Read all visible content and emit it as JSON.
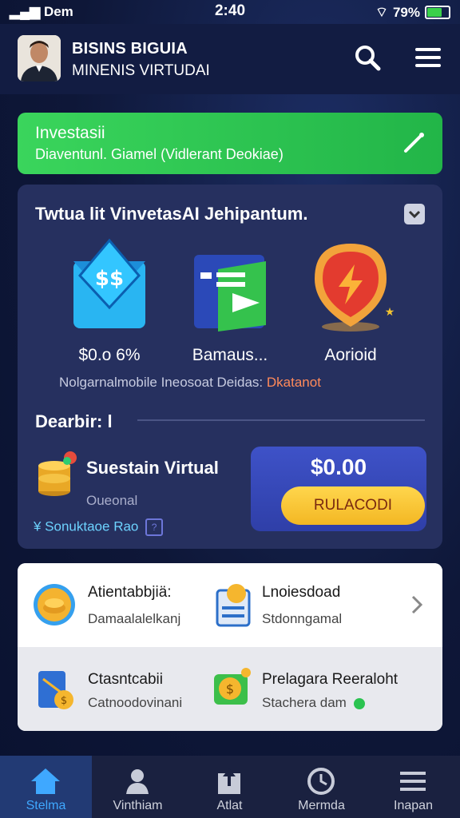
{
  "status_bar": {
    "carrier": "Dem",
    "time": "2:40",
    "battery": "79%"
  },
  "header": {
    "title_line1": "BISINS BIGUIA",
    "title_line2": "MINENIS VIRTUDAI"
  },
  "banner": {
    "title": "Investasii",
    "subtitle": "Diaventunl. Giamel (Vidlerant Deokiae)"
  },
  "card": {
    "title": "Twtua lit VinvetasAI Jehipantum.",
    "services": [
      {
        "label": "$0.o 6%"
      },
      {
        "label": "Bamaus..."
      },
      {
        "label": "Aorioid"
      }
    ],
    "sub_row_text": "Nolgarnalmobile  Ineosoat Deidas:",
    "sub_row_accent": "Dkatanot",
    "divider_label": "Dearbir: l",
    "sustain": {
      "title": "Suestain Virtual",
      "subtitle": "Oueonal",
      "link": "¥ Sonuktaoe Rao"
    },
    "payout": {
      "amount": "$0.00",
      "button": "RULACODI"
    }
  },
  "list": [
    {
      "title": "Atientabbjiä:",
      "subtitle": "Damaalalelkanj"
    },
    {
      "title": "Lnoiesdoad",
      "subtitle": "Stdonngamal"
    },
    {
      "title": "Ctasntcabii",
      "subtitle": "Catnoodovinani"
    },
    {
      "title": "Prelagara Reeraloht",
      "subtitle": "Stachera dam"
    }
  ],
  "nav": [
    {
      "label": "Stelma"
    },
    {
      "label": "Vinthiam"
    },
    {
      "label": "Atlat"
    },
    {
      "label": "Mermda"
    },
    {
      "label": "Inapan"
    }
  ],
  "colors": {
    "accent_green": "#2bc350",
    "accent_blue": "#3fa8ff",
    "pay_button": "#f8c93a"
  }
}
